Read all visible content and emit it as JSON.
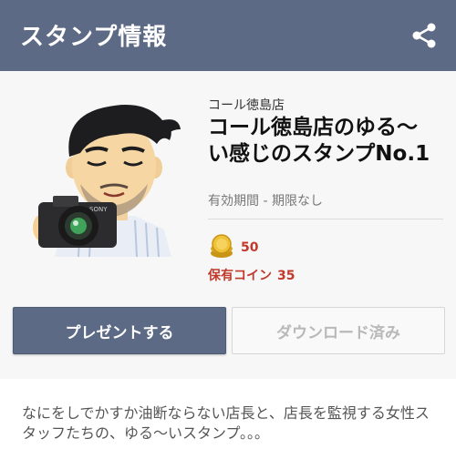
{
  "header": {
    "title": "スタンプ情報",
    "share_icon": "share-icon"
  },
  "sticker": {
    "author": "コール徳島店",
    "title": "コール徳島店のゆる〜い感じのスタンプNo.1",
    "validity": "有効期間 - 期限なし",
    "price": "50",
    "owned_label": "保有コイン",
    "owned_value": "35"
  },
  "buttons": {
    "present": "プレゼントする",
    "downloaded": "ダウンロード済み"
  },
  "description": "なにをしでかすか油断ならない店長と、店長を監視する女性スタッフたちの、ゆる〜いスタンプ。。。",
  "colors": {
    "header_bg": "#5c6a85",
    "price_red": "#c0392b",
    "coin_gold": "#e5b62a"
  }
}
